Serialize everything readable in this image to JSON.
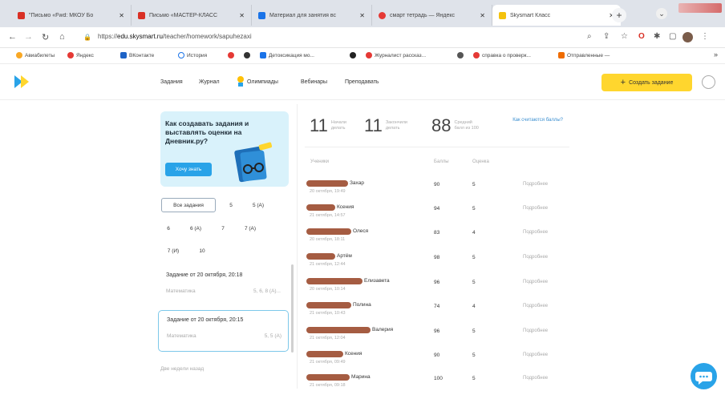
{
  "browser": {
    "tabs": [
      {
        "title": "\"Письмо «Fwd: МКОУ Бо",
        "color": "#d93025",
        "active": false
      },
      {
        "title": "Письмо «МАСТЕР-КЛАСС",
        "color": "#d93025",
        "active": false
      },
      {
        "title": "Материал для занятия вс",
        "color": "#1a73e8",
        "active": false
      },
      {
        "title": "смарт тетрадь — Яндекс",
        "color": "#e53935",
        "active": false
      },
      {
        "title": "Skysmart Класс",
        "color": "#f4c20d",
        "active": true
      }
    ],
    "url_prefix": "https://",
    "url_host": "edu.skysmart.ru",
    "url_path": "/teacher/homework/sapuhezaxi",
    "bookmarks": [
      {
        "label": "Авиабилеты",
        "color": "#f9a825"
      },
      {
        "label": "Яндекс",
        "color": "#e53935"
      },
      {
        "label": "ВКонтакте",
        "color": "#1e63c6"
      },
      {
        "label": "История",
        "color": "#ffffff"
      },
      {
        "label": "",
        "color": "#e53935"
      },
      {
        "label": "",
        "color": "#333333"
      },
      {
        "label": "Детоксикация мо...",
        "color": "#1a73e8"
      },
      {
        "label": "",
        "color": "#222222"
      },
      {
        "label": "Журналист рассказ...",
        "color": "#e53935"
      },
      {
        "label": "",
        "color": "#555555"
      },
      {
        "label": "справка о проверк...",
        "color": "#e53935"
      },
      {
        "label": "Отправленные —",
        "color": "#ef6c00"
      }
    ]
  },
  "header": {
    "menu": [
      "Задания",
      "Журнал",
      "Олимпиады",
      "Вебинары",
      "Преподавать"
    ],
    "create_label": "Создать задание",
    "create_icon": "+"
  },
  "sidebar": {
    "promo_title": "Как создавать задания и выставлять оценки на Дневник.ру?",
    "promo_button": "Хочу знать",
    "filters": [
      "Все задания",
      "5",
      "5 (А)",
      "6",
      "6 (А)",
      "7",
      "7 (А)",
      "7 (И)",
      "10"
    ],
    "tasks": [
      {
        "title": "Задание от 20 октября, 20:18",
        "subject": "Математика",
        "classes": "5, 6, 8 (А)..."
      },
      {
        "title": "Задание от 20 октября, 20:15",
        "subject": "Математика",
        "classes": "5, 5 (А)"
      }
    ],
    "week_ago": "Две недели назад"
  },
  "stats": [
    {
      "value": "11",
      "label1": "Начали",
      "label2": "делать"
    },
    {
      "value": "11",
      "label1": "Закончили",
      "label2": "делать"
    },
    {
      "value": "88",
      "label1": "Средний",
      "label2": "балл из 100"
    }
  ],
  "how_link": "Как считаются баллы?",
  "table": {
    "headers": [
      "Ученики",
      "Баллы",
      "Оценка"
    ],
    "details_label": "Подробнее",
    "rows": [
      {
        "name": "Захар",
        "date": "20 октября, 19:49",
        "points": "90",
        "grade": "5"
      },
      {
        "name": "Ксения",
        "date": "21 октября, 14:57",
        "points": "94",
        "grade": "5"
      },
      {
        "name": "Олеся",
        "date": "20 октября, 18:11",
        "points": "83",
        "grade": "4"
      },
      {
        "name": "Артём",
        "date": "21 октября, 12:44",
        "points": "98",
        "grade": "5"
      },
      {
        "name": "Елизавета",
        "date": "20 октября, 10:14",
        "points": "96",
        "grade": "5"
      },
      {
        "name": "Полина",
        "date": "21 октября, 10:43",
        "points": "74",
        "grade": "4"
      },
      {
        "name": "Валерия",
        "date": "21 октября, 12:04",
        "points": "96",
        "grade": "5"
      },
      {
        "name": "Ксения",
        "date": "21 октября, 09:49",
        "points": "90",
        "grade": "5"
      },
      {
        "name": "Марина",
        "date": "21 октября, 09:18",
        "points": "100",
        "grade": "5"
      }
    ]
  }
}
